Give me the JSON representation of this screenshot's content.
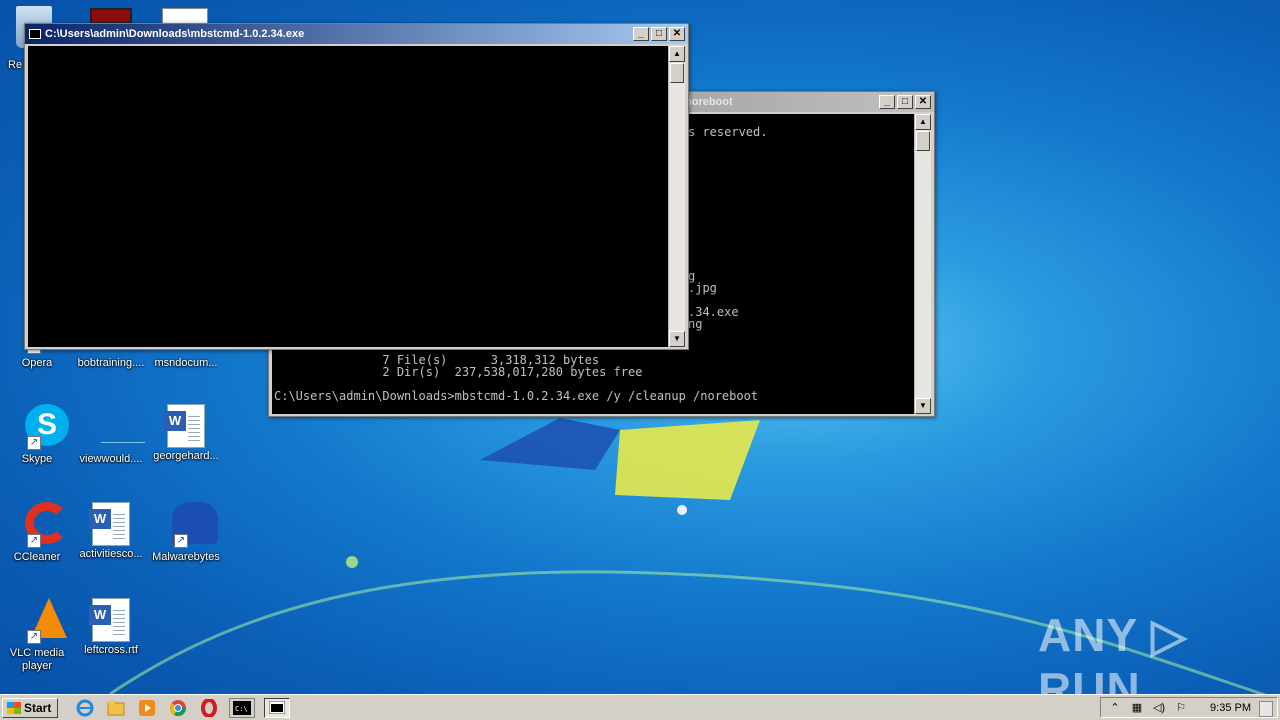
{
  "desktop_icons": [
    {
      "label": "Re"
    },
    {
      "label": "Opera"
    },
    {
      "label": "bobtraining...."
    },
    {
      "label": "msndocum..."
    },
    {
      "label": "Skype"
    },
    {
      "label": "viewwould...."
    },
    {
      "label": "georgehard..."
    },
    {
      "label": "CCleaner"
    },
    {
      "label": "activitiesco..."
    },
    {
      "label": "Malwarebytes"
    },
    {
      "label": "VLC media player"
    },
    {
      "label": "leftcross.rtf"
    }
  ],
  "back_window": {
    "title": "noreboot",
    "lines": [
      "s reserved.",
      "",
      "",
      "",
      "",
      "",
      "",
      "",
      "",
      "",
      "",
      "",
      "g",
      ".jpg",
      "",
      ".34.exe",
      "ng"
    ],
    "bottom_lines": [
      "               7 File(s)      3,318,312 bytes",
      "               2 Dir(s)  237,538,017,280 bytes free",
      "",
      "C:\\Users\\admin\\Downloads>mbstcmd-1.0.2.34.exe /y /cleanup /noreboot"
    ]
  },
  "front_window": {
    "title": "C:\\Users\\admin\\Downloads\\mbstcmd-1.0.2.34.exe"
  },
  "window_buttons": {
    "minimize": "_",
    "maximize": "□",
    "close": "✕"
  },
  "taskbar": {
    "start_label": "Start",
    "clock": "9:35 PM",
    "tray_icons": [
      "up-arrow-icon",
      "network-icon",
      "volume-icon",
      "flag-icon"
    ]
  },
  "watermark": "ANY ▷ RUN"
}
